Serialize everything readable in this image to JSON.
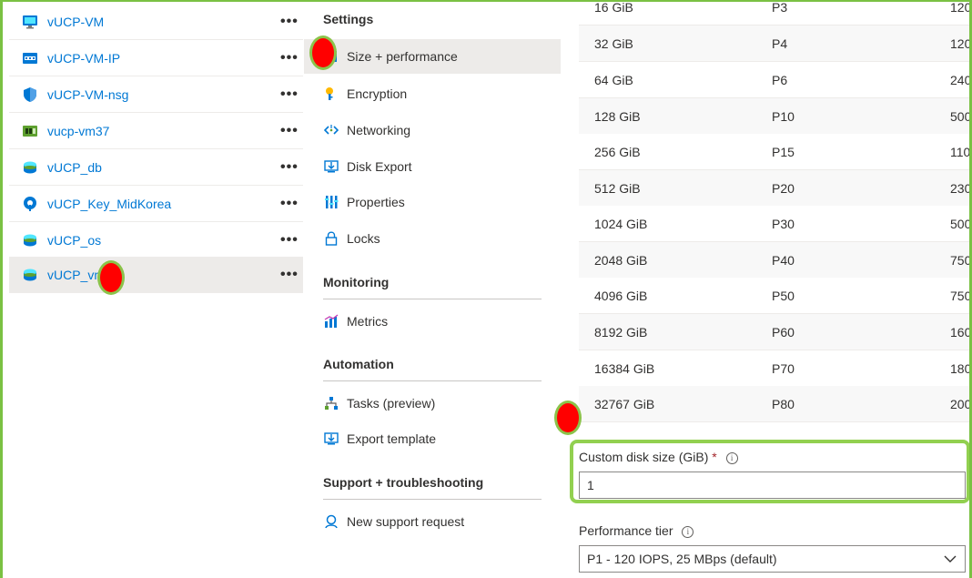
{
  "resources": [
    {
      "name": "vUCP-VM",
      "icon": "vm-icon",
      "more": "•••"
    },
    {
      "name": "vUCP-VM-IP",
      "icon": "public-ip-icon",
      "more": "•••"
    },
    {
      "name": "vUCP-VM-nsg",
      "icon": "nsg-shield-icon",
      "more": "•••"
    },
    {
      "name": "vucp-vm37",
      "icon": "network-interface-icon",
      "more": "•••"
    },
    {
      "name": "vUCP_db",
      "icon": "disk-icon",
      "more": "•••"
    },
    {
      "name": "vUCP_Key_MidKorea",
      "icon": "key-vault-icon",
      "more": "•••"
    },
    {
      "name": "vUCP_os",
      "icon": "disk-icon",
      "more": "•••"
    },
    {
      "name": "vUCP_vm",
      "icon": "disk-icon",
      "more": "•••"
    }
  ],
  "menu": {
    "settings_header": "Settings",
    "settings_items": [
      {
        "label": "Size + performance",
        "icon": "size-performance-icon"
      },
      {
        "label": "Encryption",
        "icon": "key-icon"
      },
      {
        "label": "Networking",
        "icon": "networking-icon"
      },
      {
        "label": "Disk Export",
        "icon": "disk-export-icon"
      },
      {
        "label": "Properties",
        "icon": "properties-icon"
      },
      {
        "label": "Locks",
        "icon": "lock-icon"
      }
    ],
    "monitoring_header": "Monitoring",
    "monitoring_items": [
      {
        "label": "Metrics",
        "icon": "metrics-icon"
      }
    ],
    "automation_header": "Automation",
    "automation_items": [
      {
        "label": "Tasks (preview)",
        "icon": "tasks-icon"
      },
      {
        "label": "Export template",
        "icon": "export-template-icon"
      }
    ],
    "support_header": "Support + troubleshooting",
    "support_items": [
      {
        "label": "New support request",
        "icon": "support-icon"
      }
    ]
  },
  "tiers": [
    {
      "size": "16 GiB",
      "tier": "P3",
      "iops": "120"
    },
    {
      "size": "32 GiB",
      "tier": "P4",
      "iops": "120"
    },
    {
      "size": "64 GiB",
      "tier": "P6",
      "iops": "240"
    },
    {
      "size": "128 GiB",
      "tier": "P10",
      "iops": "500"
    },
    {
      "size": "256 GiB",
      "tier": "P15",
      "iops": "110"
    },
    {
      "size": "512 GiB",
      "tier": "P20",
      "iops": "230"
    },
    {
      "size": "1024 GiB",
      "tier": "P30",
      "iops": "500"
    },
    {
      "size": "2048 GiB",
      "tier": "P40",
      "iops": "750"
    },
    {
      "size": "4096 GiB",
      "tier": "P50",
      "iops": "750"
    },
    {
      "size": "8192 GiB",
      "tier": "P60",
      "iops": "160"
    },
    {
      "size": "16384 GiB",
      "tier": "P70",
      "iops": "180"
    },
    {
      "size": "32767 GiB",
      "tier": "P80",
      "iops": "200"
    }
  ],
  "custom_disk": {
    "label": "Custom disk size (GiB)",
    "required_mark": "*",
    "info": "i",
    "value": "1"
  },
  "performance_tier": {
    "label": "Performance tier",
    "info": "i",
    "value": "P1 - 120 IOPS, 25 MBps (default)"
  },
  "colors": {
    "link": "#0078d4",
    "highlight_border": "#92d050",
    "marker": "#ff0000",
    "selected_bg": "#edebe9"
  }
}
